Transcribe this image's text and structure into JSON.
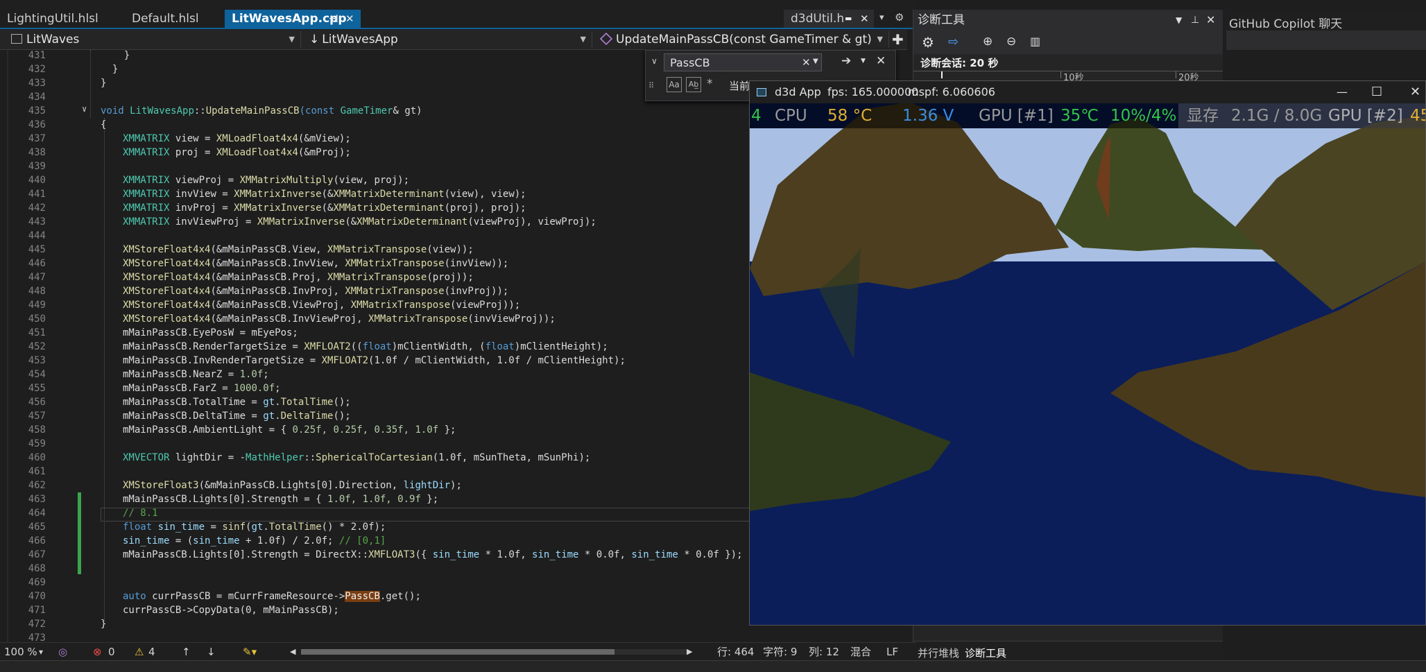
{
  "tabs": [
    {
      "label": "LightingUtil.hlsl"
    },
    {
      "label": "Default.hlsl"
    },
    {
      "label": "LitWavesApp.cpp",
      "pin": "⊣",
      "close": "✕"
    },
    {
      "label": "d3dUtil.h",
      "pin": "▬",
      "close": "✕"
    }
  ],
  "tab_overflow": {
    "caret": "▾",
    "gear": "⚙"
  },
  "nav": {
    "project": "LitWaves",
    "class": "LitWavesApp",
    "member": "UpdateMainPassCB(const GameTimer & gt)"
  },
  "find": {
    "query": "PassCB",
    "partial_label": "当前",
    "close": "✕",
    "aa": "Aa",
    "ab": "Ab̲",
    "star": "*"
  },
  "line_numbers": [
    "431",
    "432",
    "433",
    "434",
    "435",
    "436",
    "437",
    "438",
    "439",
    "440",
    "441",
    "442",
    "443",
    "444",
    "445",
    "446",
    "447",
    "448",
    "449",
    "450",
    "451",
    "452",
    "453",
    "454",
    "455",
    "456",
    "457",
    "458",
    "459",
    "460",
    "461",
    "462",
    "463",
    "464",
    "465",
    "466",
    "467",
    "468",
    "469",
    "470",
    "471",
    "472",
    "473"
  ],
  "code": {
    "l431": "    }",
    "l432": "  }",
    "l433": "}",
    "l435a": "void ",
    "l435b": "LitWavesApp",
    "l435c": "::",
    "l435d": "UpdateMainPassCB",
    "l435e": "(const ",
    "l435f": "GameTimer",
    "l435g": "& gt)",
    "l436": "{",
    "l437a": "XMMATRIX",
    "l437b": " view = ",
    "l437c": "XMLoadFloat4x4",
    "l437d": "(&mView);",
    "l438a": "XMMATRIX",
    "l438b": " proj = ",
    "l438c": "XMLoadFloat4x4",
    "l438d": "(&mProj);",
    "l440a": "XMMATRIX",
    "l440b": " viewProj = ",
    "l440c": "XMMatrixMultiply",
    "l440d": "(view, proj);",
    "l441a": "XMMATRIX",
    "l441b": " invView = ",
    "l441c": "XMMatrixInverse",
    "l441d": "(&",
    "l441e": "XMMatrixDeterminant",
    "l441f": "(view), view);",
    "l442a": "XMMATRIX",
    "l442b": " invProj = ",
    "l442c": "XMMatrixInverse",
    "l442d": "(&",
    "l442e": "XMMatrixDeterminant",
    "l442f": "(proj), proj);",
    "l443a": "XMMATRIX",
    "l443b": " invViewProj = ",
    "l443c": "XMMatrixInverse",
    "l443d": "(&",
    "l443e": "XMMatrixDeterminant",
    "l443f": "(viewProj), viewProj);",
    "l445a": "XMStoreFloat4x4",
    "l445b": "(&mMainPassCB.View, ",
    "l445c": "XMMatrixTranspose",
    "l445d": "(view));",
    "l446a": "XMStoreFloat4x4",
    "l446b": "(&mMainPassCB.InvView, ",
    "l446c": "XMMatrixTranspose",
    "l446d": "(invView));",
    "l447a": "XMStoreFloat4x4",
    "l447b": "(&mMainPassCB.Proj, ",
    "l447c": "XMMatrixTranspose",
    "l447d": "(proj));",
    "l448a": "XMStoreFloat4x4",
    "l448b": "(&mMainPassCB.InvProj, ",
    "l448c": "XMMatrixTranspose",
    "l448d": "(invProj));",
    "l449a": "XMStoreFloat4x4",
    "l449b": "(&mMainPassCB.ViewProj, ",
    "l449c": "XMMatrixTranspose",
    "l449d": "(viewProj));",
    "l450a": "XMStoreFloat4x4",
    "l450b": "(&mMainPassCB.InvViewProj, ",
    "l450c": "XMMatrixTranspose",
    "l450d": "(invViewProj));",
    "l451": "mMainPassCB.EyePosW = mEyePos;",
    "l452a": "mMainPassCB.RenderTargetSize = ",
    "l452b": "XMFLOAT2",
    "l452c": "((",
    "l452d": "float",
    "l452e": ")mClientWidth, (",
    "l452f": "float",
    "l452g": ")mClientHeight);",
    "l453a": "mMainPassCB.InvRenderTargetSize = ",
    "l453b": "XMFLOAT2",
    "l453c": "(1.0f / mClientWidth, 1.0f / mClientHeight);",
    "l454a": "mMainPassCB.NearZ = ",
    "l454b": "1.0f",
    "l454c": ";",
    "l455a": "mMainPassCB.FarZ = ",
    "l455b": "1000.0f",
    "l455c": ";",
    "l456a": "mMainPassCB.TotalTime = ",
    "l456b": "gt",
    "l456c": ".",
    "l456d": "TotalTime",
    "l456e": "();",
    "l457a": "mMainPassCB.DeltaTime = ",
    "l457b": "gt",
    "l457c": ".",
    "l457d": "DeltaTime",
    "l457e": "();",
    "l458a": "mMainPassCB.AmbientLight = { ",
    "l458b": "0.25f, 0.25f, 0.35f, 1.0f",
    "l458c": " };",
    "l460a": "XMVECTOR",
    "l460b": " lightDir = -",
    "l460c": "MathHelper",
    "l460d": "::",
    "l460e": "SphericalToCartesian",
    "l460f": "(1.0f, mSunTheta, mSunPhi);",
    "l462a": "XMStoreFloat3",
    "l462b": "(&mMainPassCB.Lights[0].Direction, ",
    "l462c": "lightDir",
    "l462d": ");",
    "l463a": "mMainPassCB.Lights[0].Strength = { ",
    "l463b": "1.0f, 1.0f, 0.9f",
    "l463c": " };",
    "l464": "// 8.1",
    "l465a": "float",
    "l465b": " ",
    "l465c": "sin_time",
    "l465d": " = ",
    "l465e": "sinf",
    "l465f": "(",
    "l465g": "gt",
    "l465h": ".",
    "l465i": "TotalTime",
    "l465j": "() * 2.0f);",
    "l466a": "sin_time",
    "l466b": " = (",
    "l466c": "sin_time",
    "l466d": " + 1.0f) / 2.0f; ",
    "l466e": "// [0,1]",
    "l467a": "mMainPassCB.Lights[0].Strength = DirectX::",
    "l467b": "XMFLOAT3",
    "l467c": "({ ",
    "l467d": "sin_time",
    "l467e": " * 1.0f, ",
    "l467f": "sin_time",
    "l467g": " * 0.0f, ",
    "l467h": "sin_time",
    "l467i": " * 0.0f });",
    "l470a": "auto",
    "l470b": " currPassCB = mCurrFrameResource->",
    "l470c": "PassCB",
    "l470d": ".get();",
    "l471": "currPassCB->CopyData(0, mMainPassCB);",
    "l472": "}"
  },
  "status": {
    "zoom": "100 %",
    "errors": "0",
    "warnings": "4",
    "line": "行: 464",
    "char": "字符: 9",
    "col": "列: 12",
    "indent": "混合",
    "eol": "LF"
  },
  "diag": {
    "title": "诊断工具",
    "session": "诊断会话: 20 秒",
    "tick1": "10秒",
    "tick2": "20秒",
    "bottom_tab1": "并行堆栈",
    "bottom_tab2": "诊断工具"
  },
  "copilot": {
    "title": "GitHub Copilot 聊天"
  },
  "d3d": {
    "title": "d3d App",
    "fps": "fps: 165.000000",
    "mspf": "mspf: 6.060606",
    "osd": {
      "lead": "4",
      "cpu_label": "CPU",
      "cpu_temp": "58 °C",
      "cpu_volt": "1.36 V",
      "gpu1_label": "GPU [#1]",
      "gpu1_temp": "35℃",
      "gpu1_load": "10%/4%",
      "vram_label": "显存",
      "vram_value": "2.1G / 8.0G",
      "gpu2_label": "GPU [#2]",
      "gpu2_temp": "45"
    }
  },
  "colors": {
    "accent": "#0e639c",
    "sky": "#a9c0e4",
    "water": "#0b1e5a",
    "terrain": "#4a3a1c",
    "osd_yellow": "#e0b030",
    "osd_blue": "#3a8ee6",
    "osd_green": "#33c44a"
  }
}
